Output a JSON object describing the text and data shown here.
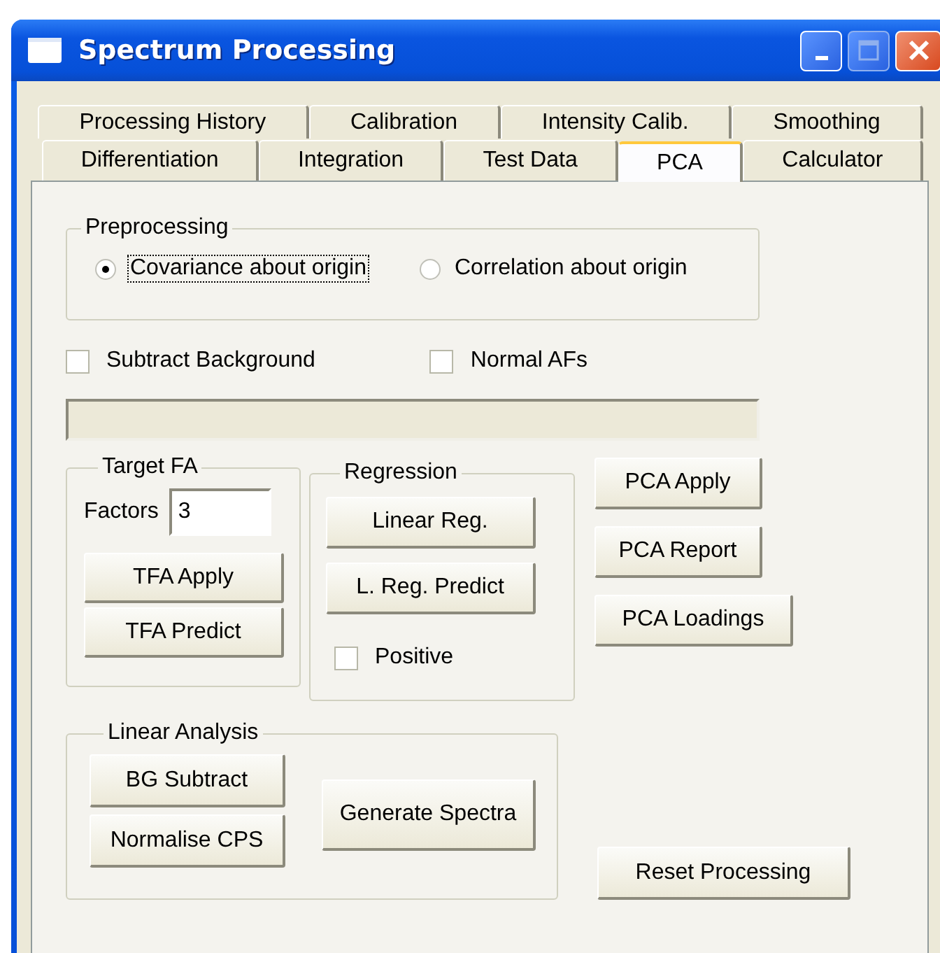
{
  "window": {
    "title": "Spectrum Processing",
    "maximize_enabled": false
  },
  "tab_rows": [
    {
      "tabs": [
        {
          "label": "Processing History",
          "selected": false
        },
        {
          "label": "Calibration",
          "selected": false
        },
        {
          "label": "Intensity Calib.",
          "selected": false
        },
        {
          "label": "Smoothing",
          "selected": false
        }
      ]
    },
    {
      "tabs": [
        {
          "label": "Differentiation",
          "selected": false
        },
        {
          "label": "Integration",
          "selected": false
        },
        {
          "label": "Test Data",
          "selected": false
        },
        {
          "label": "PCA",
          "selected": true
        },
        {
          "label": "Calculator",
          "selected": false
        }
      ]
    }
  ],
  "preprocessing": {
    "title": "Preprocessing",
    "options": [
      {
        "label": "Covariance about origin",
        "selected": true,
        "focused": true
      },
      {
        "label": "Correlation about origin",
        "selected": false,
        "focused": false
      }
    ]
  },
  "checkboxes": [
    {
      "label": "Subtract Background",
      "checked": false
    },
    {
      "label": "Normal AFs",
      "checked": false
    }
  ],
  "target_fa": {
    "title": "Target FA",
    "factors_label": "Factors",
    "factors_value": "3",
    "buttons": [
      "TFA Apply",
      "TFA Predict"
    ]
  },
  "regression": {
    "title": "Regression",
    "buttons": [
      "Linear Reg.",
      "L. Reg. Predict"
    ],
    "positive": {
      "label": "Positive",
      "checked": false
    }
  },
  "pca_buttons": [
    "PCA Apply",
    "PCA Report",
    "PCA Loadings"
  ],
  "linear_analysis": {
    "title": "Linear Analysis",
    "buttons": [
      "BG Subtract",
      "Normalise CPS"
    ],
    "generate": "Generate Spectra"
  },
  "reset_button": "Reset Processing"
}
